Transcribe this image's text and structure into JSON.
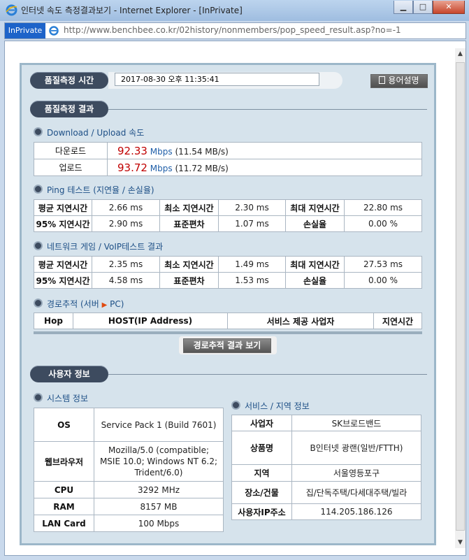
{
  "window": {
    "title": "인터넷 속도 측정결과보기 - Internet Explorer - [InPrivate]",
    "inprivate_label": "InPrivate",
    "url": "http://www.benchbee.co.kr/02history/nonmembers/pop_speed_result.asp?no=-1"
  },
  "header": {
    "time_label": "품질측정 시간",
    "time_value": "2017-08-30 오후 11:35:41",
    "glossary_label": "용어설명",
    "result_label": "품질측정 결과"
  },
  "speed": {
    "title": "Download / Upload 속도",
    "rows": [
      {
        "label": "다운로드",
        "value": "92.33",
        "unit": "Mbps",
        "mb": "(11.54 MB/s)"
      },
      {
        "label": "업로드",
        "value": "93.72",
        "unit": "Mbps",
        "mb": "(11.72 MB/s)"
      }
    ]
  },
  "ping": {
    "title": "Ping 테스트 (지연율 / 손실율)",
    "rows": [
      [
        "평균 지연시간",
        "2.66 ms",
        "최소 지연시간",
        "2.30 ms",
        "최대 지연시간",
        "22.80 ms"
      ],
      [
        "95% 지연시간",
        "2.90 ms",
        "표준편차",
        "1.07 ms",
        "손실율",
        "0.00 %"
      ]
    ]
  },
  "game": {
    "title": "네트워크 게임 / VoIP테스트 결과",
    "rows": [
      [
        "평균 지연시간",
        "2.35 ms",
        "최소 지연시간",
        "1.49 ms",
        "최대 지연시간",
        "27.53 ms"
      ],
      [
        "95% 지연시간",
        "4.58 ms",
        "표준편차",
        "1.53 ms",
        "손실율",
        "0.00 %"
      ]
    ]
  },
  "trace": {
    "title_prefix": "경로추적 (서버",
    "title_suffix": "PC)",
    "headers": [
      "Hop",
      "HOST(IP Address)",
      "서비스 제공 사업자",
      "지연시간"
    ],
    "button_label": "경로추적 결과 보기"
  },
  "user": {
    "title": "사용자 정보",
    "system_title": "시스템 정보",
    "system": [
      {
        "label": "OS",
        "value": "Service Pack 1 (Build 7601)"
      },
      {
        "label": "웹브라우저",
        "value": "Mozilla/5.0 (compatible; MSIE 10.0; Windows NT 6.2; Trident/6.0)"
      },
      {
        "label": "CPU",
        "value": "3292 MHz"
      },
      {
        "label": "RAM",
        "value": "8157 MB"
      },
      {
        "label": "LAN Card",
        "value": "100 Mbps"
      }
    ],
    "service_title": "서비스 / 지역 정보",
    "service": [
      {
        "label": "사업자",
        "value": "SK브로드밴드"
      },
      {
        "label": "상품명",
        "value": "B인터넷 광랜(일반/FTTH)"
      },
      {
        "label": "지역",
        "value": "서울영등포구"
      },
      {
        "label": "장소/건물",
        "value": "집/단독주택/다세대주택/빌라"
      },
      {
        "label": "사용자IP주소",
        "value": "114.205.186.126"
      }
    ]
  },
  "icons": [
    "ie-icon",
    "page-icon",
    "minimize-icon",
    "maximize-icon",
    "close-icon",
    "scroll-up-icon",
    "scroll-down-icon",
    "glossary-icon",
    "bullet-icon",
    "arrow-right-icon"
  ],
  "colors": {
    "accent": "#c00000",
    "label_blue": "#1d4f86",
    "pill": "#3d4b5f",
    "inprivate": "#1d63c9"
  }
}
